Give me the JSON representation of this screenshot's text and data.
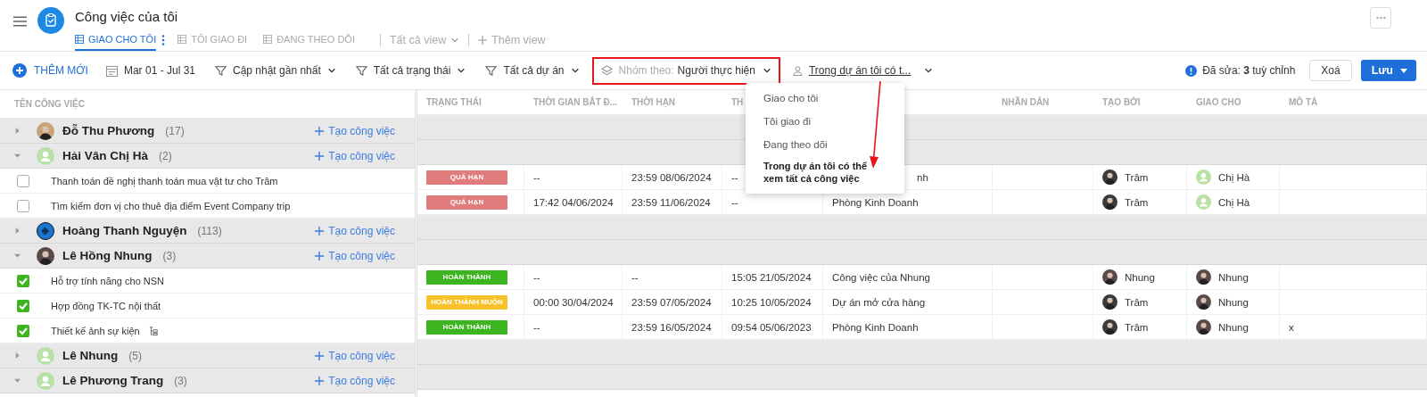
{
  "app": {
    "title": "Công việc của tôi"
  },
  "tabs": [
    {
      "label": "GIAO CHO TÔI",
      "selected": true
    },
    {
      "label": "TÔI GIAO ĐI",
      "selected": false
    },
    {
      "label": "ĐANG THEO DÕI",
      "selected": false
    }
  ],
  "view_links": [
    {
      "label": "Tất cả view",
      "kind": "dropdown"
    },
    {
      "label": "Thêm view",
      "kind": "add"
    }
  ],
  "toolbar": {
    "add_button": "THÊM MỚI",
    "date_range": "Mar 01 - Jul 31",
    "filters": [
      "Cập nhật gần nhất",
      "Tất cả trạng thái",
      "Tất cả dự án"
    ],
    "group_by": {
      "label": "Nhóm theo:",
      "value": "Người thực hiện",
      "highlighted": true
    },
    "scope": "Trong dự án tôi có t...",
    "edited_notice": "Đã sửa: **3** tuỳ chỉnh",
    "clear_button": "Xoá",
    "save_button": "Lưu"
  },
  "scope_menu": {
    "items": [
      {
        "label": "Giao cho tôi",
        "selected": false
      },
      {
        "label": "Tôi giao đi",
        "selected": false
      },
      {
        "label": "Đang theo dõi",
        "selected": false
      },
      {
        "label": "Trong dự án tôi có thể xem tất cả công việc",
        "selected": true
      }
    ]
  },
  "table": {
    "task_column": "TÊN CÔNG VIỆC",
    "columns": [
      {
        "label": "TRẠNG THÁI"
      },
      {
        "label": "THỜI GIAN BẮT Đ..."
      },
      {
        "label": "THỜI HẠN"
      },
      {
        "label": "TH"
      },
      {},
      {
        "label": "NHÃN DÁN"
      },
      {
        "label": "TẠO BỞI"
      },
      {
        "label": "GIAO CHO"
      },
      {
        "label": "MÔ TẢ"
      }
    ],
    "groups": [
      {
        "name": "Đỗ Thu Phương",
        "count": "(17)",
        "add_label": "Tạo công việc",
        "expanded": false,
        "avatar": {
          "kind": "photo",
          "color": "#c8a474"
        }
      },
      {
        "name": "Hải Vân Chị Hà",
        "count": "(2)",
        "add_label": "Tạo công việc",
        "expanded": true,
        "avatar": {
          "kind": "placeholder"
        },
        "tasks": [
          {
            "title": "Thanh toán đề nghị thanh toán mua vật tư cho Trâm",
            "checked": false,
            "status": {
              "label": "QUÁ HẠN",
              "kind": "overdue"
            },
            "start": "--",
            "due": "23:59 08/06/2024",
            "done": "--",
            "project": "nh",
            "created_by": {
              "name": "Trâm",
              "avatar": {
                "kind": "photo",
                "color": "#3b3b3b"
              }
            },
            "assignee": {
              "name": "Chị Hà",
              "avatar": {
                "kind": "placeholder"
              }
            }
          },
          {
            "title": "Tìm kiếm đơn vị cho thuê địa điểm Event Company trip",
            "checked": false,
            "status": {
              "label": "QUÁ HẠN",
              "kind": "overdue"
            },
            "start": "17:42 04/06/2024",
            "due": "23:59 11/06/2024",
            "done": "--",
            "project": "Phòng Kinh Doanh",
            "created_by": {
              "name": "Trâm",
              "avatar": {
                "kind": "photo",
                "color": "#3b3b3b"
              }
            },
            "assignee": {
              "name": "Chị Hà",
              "avatar": {
                "kind": "placeholder"
              }
            }
          }
        ]
      },
      {
        "name": "Hoàng Thanh Nguyện",
        "count": "(113)",
        "add_label": "Tạo công việc",
        "expanded": false,
        "avatar": {
          "kind": "icon"
        }
      },
      {
        "name": "Lê Hồng Nhung",
        "count": "(3)",
        "add_label": "Tạo công việc",
        "expanded": true,
        "avatar": {
          "kind": "photo",
          "color": "#5a4a48"
        },
        "tasks": [
          {
            "title": "Hỗ trợ tính năng cho NSN",
            "checked": true,
            "status": {
              "label": "HOÀN THÀNH",
              "kind": "done"
            },
            "start": "--",
            "due": "--",
            "done": "15:05 21/05/2024",
            "project": "Công việc của Nhung",
            "created_by": {
              "name": "Nhung",
              "avatar": {
                "kind": "photo",
                "color": "#5a4a48"
              }
            },
            "assignee": {
              "name": "Nhung",
              "avatar": {
                "kind": "photo",
                "color": "#5a4a48"
              }
            }
          },
          {
            "title": "Hợp đồng TK-TC nội thất",
            "checked": true,
            "status": {
              "label": "HOÀN THÀNH MUỘN",
              "kind": "late"
            },
            "start": "00:00 30/04/2024",
            "due": "23:59 07/05/2024",
            "done": "10:25 10/05/2024",
            "project": "Dự án mở cửa hàng",
            "created_by": {
              "name": "Trâm",
              "avatar": {
                "kind": "photo",
                "color": "#3b3b3b"
              }
            },
            "assignee": {
              "name": "Nhung",
              "avatar": {
                "kind": "photo",
                "color": "#5a4a48"
              }
            }
          },
          {
            "title": "Thiết kế ảnh sự kiện",
            "checked": true,
            "has_subtasks": true,
            "status": {
              "label": "HOÀN THÀNH",
              "kind": "done"
            },
            "start": "--",
            "due": "23:59 16/05/2024",
            "done": "09:54 05/06/2023",
            "project": "Phòng Kinh Doanh",
            "created_by": {
              "name": "Trâm",
              "avatar": {
                "kind": "photo",
                "color": "#3b3b3b"
              }
            },
            "assignee": {
              "name": "Nhung",
              "avatar": {
                "kind": "photo",
                "color": "#5a4a48"
              }
            },
            "description": "x"
          }
        ]
      },
      {
        "name": "Lê Nhung",
        "count": "(5)",
        "add_label": "Tạo công việc",
        "expanded": false,
        "avatar": {
          "kind": "placeholder"
        }
      },
      {
        "name": "Lê Phương Trang",
        "count": "(3)",
        "add_label": "Tạo công việc",
        "expanded": true,
        "avatar": {
          "kind": "placeholder"
        }
      }
    ]
  }
}
